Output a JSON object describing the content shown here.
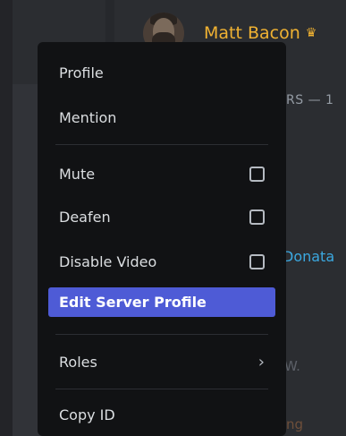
{
  "member": {
    "name": "Matt Bacon",
    "crown_icon": "crown-icon",
    "name_color": "#f0b232"
  },
  "background": {
    "members_header": "RS — 1",
    "name_donata": "Donata",
    "name_w": "W.",
    "name_ng": "ng"
  },
  "context_menu": {
    "profile": "Profile",
    "mention": "Mention",
    "mute": "Mute",
    "deafen": "Deafen",
    "disable_video": "Disable Video",
    "edit_server_profile": "Edit Server Profile",
    "roles": "Roles",
    "copy_id": "Copy ID",
    "highlight_color": "#4e5bd6"
  }
}
